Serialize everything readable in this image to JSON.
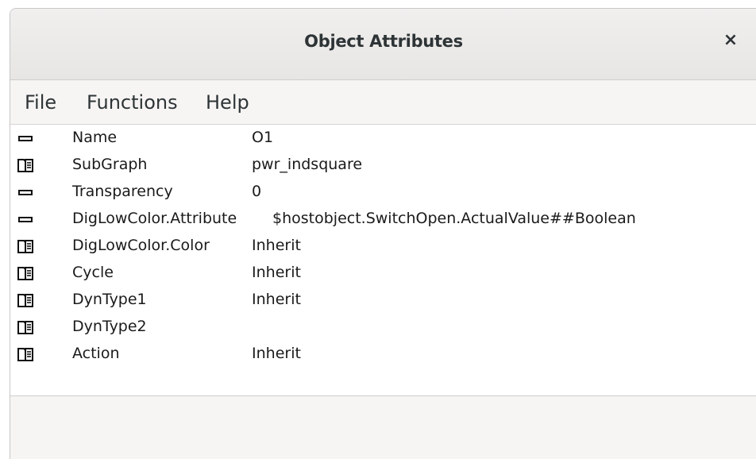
{
  "window": {
    "title": "Object Attributes",
    "close_label": "×"
  },
  "menu": {
    "items": [
      {
        "label": "File"
      },
      {
        "label": "Functions"
      },
      {
        "label": "Help"
      }
    ]
  },
  "attributes": [
    {
      "name": "Name",
      "value": "O1",
      "icon": "dash-icon"
    },
    {
      "name": "SubGraph",
      "value": "pwr_indsquare",
      "icon": "folder-icon"
    },
    {
      "name": "Transparency",
      "value": "0",
      "icon": "dash-icon"
    },
    {
      "name": "DigLowColor.Attribute",
      "value": "$hostobject.SwitchOpen.ActualValue##Boolean",
      "icon": "dash-icon"
    },
    {
      "name": "DigLowColor.Color",
      "value": "Inherit",
      "icon": "folder-icon"
    },
    {
      "name": "Cycle",
      "value": "Inherit",
      "icon": "folder-icon"
    },
    {
      "name": "DynType1",
      "value": "Inherit",
      "icon": "folder-icon"
    },
    {
      "name": "DynType2",
      "value": "",
      "icon": "folder-icon"
    },
    {
      "name": "Action",
      "value": "Inherit",
      "icon": "folder-icon"
    }
  ]
}
